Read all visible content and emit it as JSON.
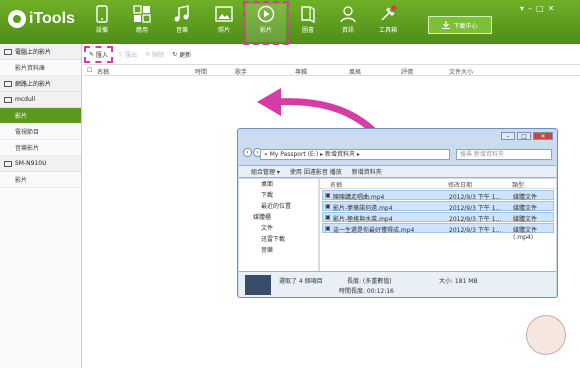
{
  "app": {
    "name": "iTools"
  },
  "nav": [
    {
      "label": "設備",
      "icon": "phone-icon"
    },
    {
      "label": "應用",
      "icon": "apps-icon"
    },
    {
      "label": "音樂",
      "icon": "music-icon"
    },
    {
      "label": "照片",
      "icon": "photo-icon"
    },
    {
      "label": "影片",
      "icon": "video-icon",
      "selected": true
    },
    {
      "label": "圖書",
      "icon": "book-icon"
    },
    {
      "label": "資訊",
      "icon": "contacts-icon"
    },
    {
      "label": "工具箱",
      "icon": "toolbox-icon"
    }
  ],
  "download_center": "下載中心",
  "sidebar": {
    "sections": [
      {
        "title": "電腦上的影片",
        "items": [
          {
            "label": "影片資料庫"
          }
        ]
      },
      {
        "title": "網路上的影片",
        "items": []
      },
      {
        "title": "mcdull",
        "items": [
          {
            "label": "影片",
            "selected": true
          },
          {
            "label": "電視節目"
          },
          {
            "label": "音樂影片"
          }
        ]
      },
      {
        "title": "SM-N910U",
        "items": [
          {
            "label": "影片"
          }
        ]
      }
    ]
  },
  "toolbar": {
    "import": "匯入",
    "export": "匯出",
    "delete": "刪除",
    "refresh": "更新"
  },
  "columns": {
    "name": "名稱",
    "time": "時間",
    "artist": "歌手",
    "album": "專輯",
    "genre": "風格",
    "rating": "評價",
    "size": "文件大小"
  },
  "explorer": {
    "address": "« My Passport (E:) ▸ 新增資料夾 ▸",
    "search_placeholder": "搜尋 新增資料夾",
    "commands": {
      "organize": "組合管理 ▾",
      "play": "使用 因遠影音 播放",
      "new_folder": "新增資料夾"
    },
    "tree": [
      {
        "label": "桌面"
      },
      {
        "label": "下載"
      },
      {
        "label": "最近的位置"
      },
      {
        "label": "媒體櫃",
        "group": true
      },
      {
        "label": "文件"
      },
      {
        "label": "迅雷下載"
      },
      {
        "label": "音樂"
      }
    ],
    "headers": {
      "name": "名稱",
      "date": "修改日期",
      "type": "類型"
    },
    "files": [
      {
        "name": "陳陳講走唱曲.mp4",
        "date": "2012/9/3 下午 1...",
        "type": "媒體文件(.mp4)"
      },
      {
        "name": "影片-夢華諾何遠.mp4",
        "date": "2012/9/3 下午 1...",
        "type": "媒體文件(.mp4)"
      },
      {
        "name": "影片-極搖與水菜.mp4",
        "date": "2012/9/3 下午 1...",
        "type": "媒體文件(.mp4)"
      },
      {
        "name": "這一生還是你最好懂得成.mp4",
        "date": "2012/9/3 下午 1...",
        "type": "媒體文件(.mp4)"
      }
    ],
    "status": {
      "selected": "選取了 4 個項目",
      "duration_label": "長度: (多重數值)",
      "size": "大小: 181 MB",
      "total_label": "時間長度: 00:12:16"
    }
  },
  "colors": {
    "brand": "#5a9a1e",
    "highlight": "#d63ca6",
    "arrow": "#d63ca6"
  }
}
